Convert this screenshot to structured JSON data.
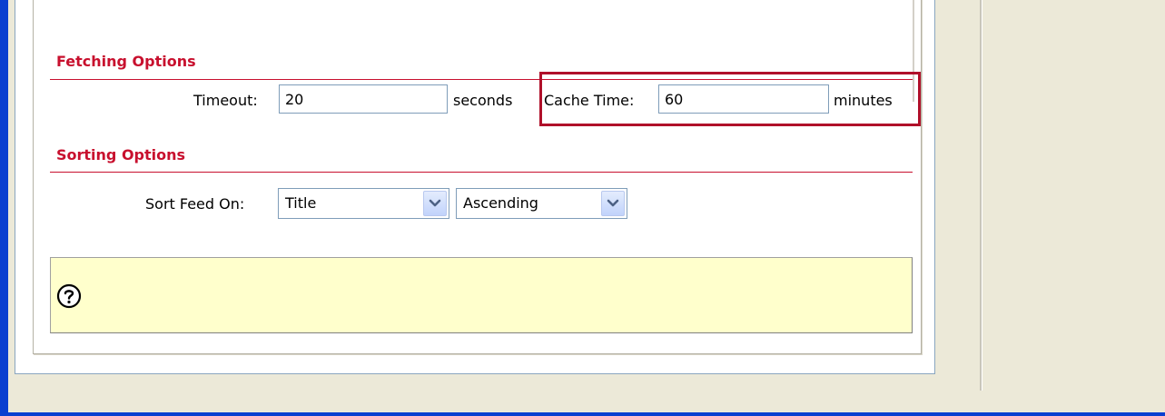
{
  "sections": {
    "fetching": {
      "title": "Fetching Options"
    },
    "sorting": {
      "title": "Sorting Options"
    }
  },
  "fetching": {
    "timeout_label": "Timeout:",
    "timeout_value": "20",
    "timeout_unit": "seconds",
    "cache_label": "Cache Time:",
    "cache_value": "60",
    "cache_unit": "minutes"
  },
  "sorting": {
    "sort_label": "Sort Feed On:",
    "sort_field": "Title",
    "sort_order": "Ascending"
  },
  "help": {
    "icon": "question-circle-icon"
  },
  "colors": {
    "section_header": "#c8102e",
    "highlight_border": "#b0102a",
    "help_background": "#ffffcc",
    "window_border": "#0a3fd0"
  }
}
